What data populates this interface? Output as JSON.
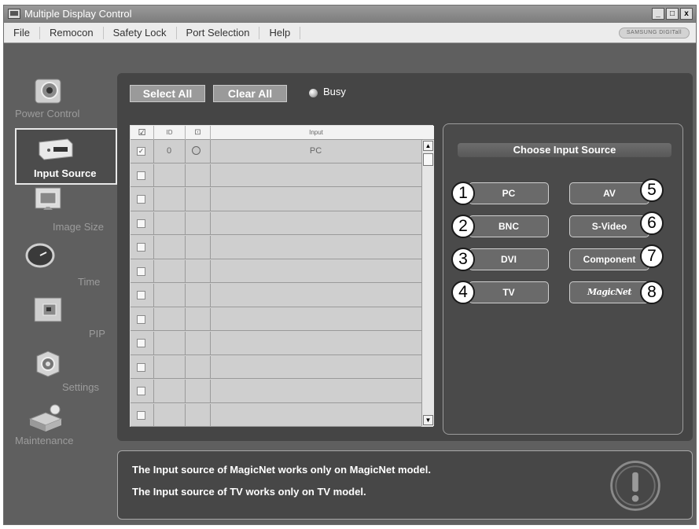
{
  "window": {
    "title": "Multiple Display Control",
    "buttons": [
      "_",
      "□",
      "x"
    ]
  },
  "menu": {
    "items": [
      "File",
      "Remocon",
      "Safety Lock",
      "Port Selection",
      "Help"
    ],
    "brand": "SAMSUNG DIGITall"
  },
  "nav": {
    "items": [
      {
        "label": "Power Control",
        "icon": "power-control-icon"
      },
      {
        "label": "Input Source",
        "icon": "input-source-icon",
        "selected": true
      },
      {
        "label": "Image Size",
        "icon": "image-size-icon"
      },
      {
        "label": "Time",
        "icon": "clock-icon"
      },
      {
        "label": "PIP",
        "icon": "pip-icon"
      },
      {
        "label": "Settings",
        "icon": "settings-icon"
      },
      {
        "label": "Maintenance",
        "icon": "maintenance-icon"
      }
    ]
  },
  "toolbar": {
    "select_all": "Select All",
    "clear_all": "Clear All",
    "busy": "Busy"
  },
  "grid": {
    "headers": {
      "check": "☑",
      "id": "ID",
      "status": "⊡",
      "input": "Input"
    },
    "rows": [
      {
        "checked": true,
        "id": "0",
        "status": true,
        "input": "PC"
      },
      {
        "checked": false,
        "id": "",
        "status": false,
        "input": ""
      },
      {
        "checked": false,
        "id": "",
        "status": false,
        "input": ""
      },
      {
        "checked": false,
        "id": "",
        "status": false,
        "input": ""
      },
      {
        "checked": false,
        "id": "",
        "status": false,
        "input": ""
      },
      {
        "checked": false,
        "id": "",
        "status": false,
        "input": ""
      },
      {
        "checked": false,
        "id": "",
        "status": false,
        "input": ""
      },
      {
        "checked": false,
        "id": "",
        "status": false,
        "input": ""
      },
      {
        "checked": false,
        "id": "",
        "status": false,
        "input": ""
      },
      {
        "checked": false,
        "id": "",
        "status": false,
        "input": ""
      },
      {
        "checked": false,
        "id": "",
        "status": false,
        "input": ""
      },
      {
        "checked": false,
        "id": "",
        "status": false,
        "input": ""
      }
    ]
  },
  "panel": {
    "title": "Choose Input Source",
    "sources": [
      {
        "num": "1",
        "label": "PC"
      },
      {
        "num": "2",
        "label": "BNC"
      },
      {
        "num": "3",
        "label": "DVI"
      },
      {
        "num": "4",
        "label": "TV"
      },
      {
        "num": "5",
        "label": "AV"
      },
      {
        "num": "6",
        "label": "S-Video"
      },
      {
        "num": "7",
        "label": "Component"
      },
      {
        "num": "8",
        "label": "MagicNet"
      }
    ]
  },
  "info": {
    "line1": "The Input source of MagicNet works only on MagicNet model.",
    "line2": "The Input source of TV works only on TV  model."
  },
  "colors": {
    "background": "#5f5f5f",
    "panel": "#454545",
    "grid": "#cfcfcf",
    "button": "#6a6a6a"
  }
}
